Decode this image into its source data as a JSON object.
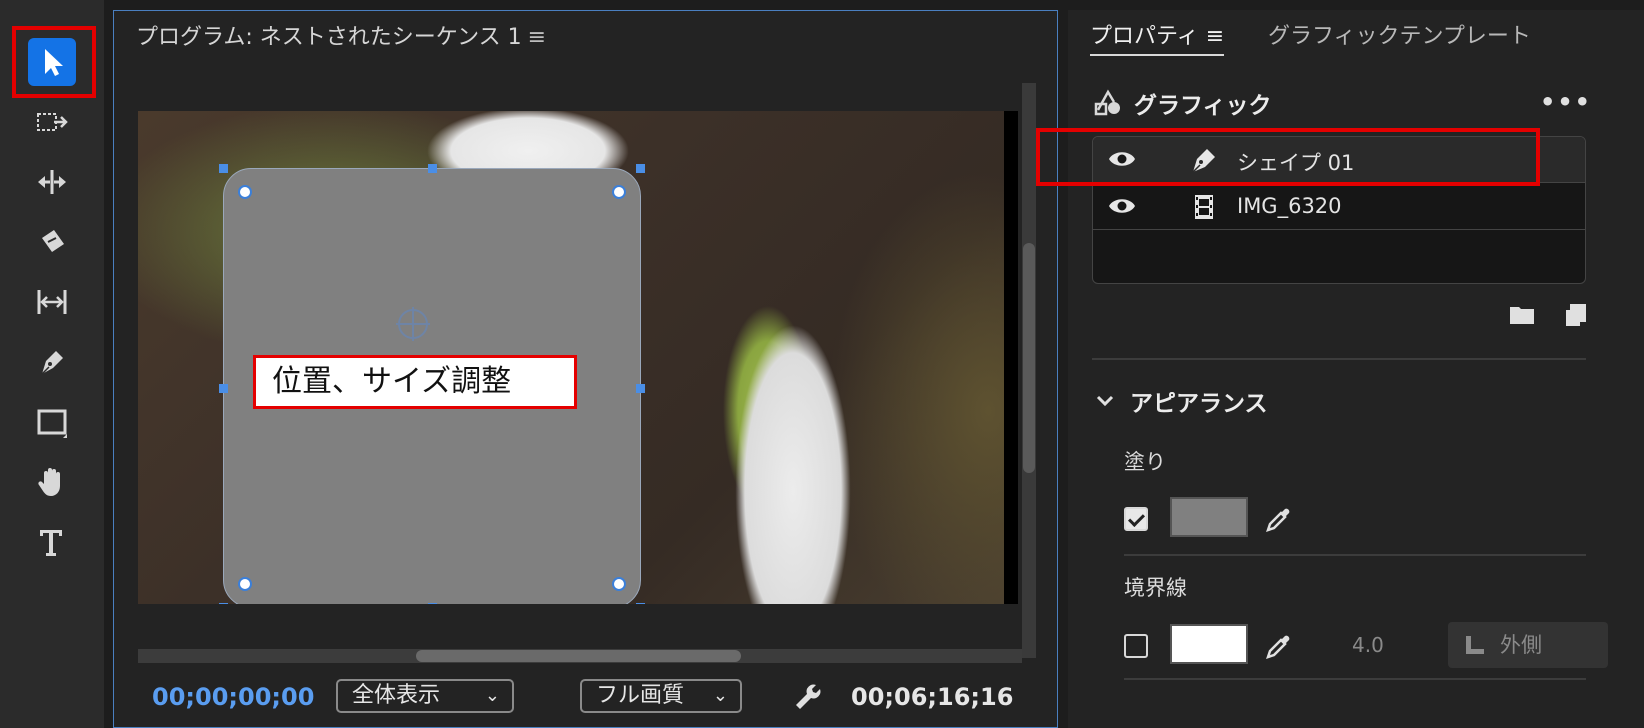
{
  "monitor": {
    "title": "プログラム: ネストされたシーケンス 1",
    "menu_glyph": "≡",
    "callout": "位置、サイズ調整",
    "timecode_current": "00;00;00;00",
    "timecode_duration": "00;06;16;16",
    "zoom_select": "全体表示",
    "quality_select": "フル画質"
  },
  "tools": [
    {
      "name": "selection-tool",
      "icon": "arrow-icon",
      "active": true
    },
    {
      "name": "track-select-forward-tool",
      "icon": "track-select-icon"
    },
    {
      "name": "ripple-edit-tool",
      "icon": "ripple-edit-icon"
    },
    {
      "name": "razor-tool",
      "icon": "razor-icon"
    },
    {
      "name": "slip-tool",
      "icon": "slip-icon"
    },
    {
      "name": "pen-tool",
      "icon": "pen-icon"
    },
    {
      "name": "rectangle-tool",
      "icon": "rectangle-icon"
    },
    {
      "name": "hand-tool",
      "icon": "hand-icon"
    },
    {
      "name": "type-tool",
      "icon": "type-icon"
    }
  ],
  "properties": {
    "tab_active": "プロパティ",
    "tab_menu": "≡",
    "tab_inactive": "グラフィックテンプレート",
    "graphic_title": "グラフィック",
    "more": "•••",
    "layers": [
      {
        "name": "シェイプ 01",
        "type_icon": "pen-icon",
        "selected": true
      },
      {
        "name": "IMG_6320",
        "type_icon": "film-icon",
        "selected": false
      }
    ],
    "appearance_title": "アピアランス",
    "fill_label": "塗り",
    "fill_checked": true,
    "fill_color": "#808080",
    "stroke_label": "境界線",
    "stroke_checked": false,
    "stroke_color": "#ffffff",
    "stroke_width": "4.0",
    "stroke_position": "外側"
  },
  "colors": {
    "accent": "#1473e6",
    "highlight": "#e40000",
    "timecode": "#5a9df0"
  }
}
